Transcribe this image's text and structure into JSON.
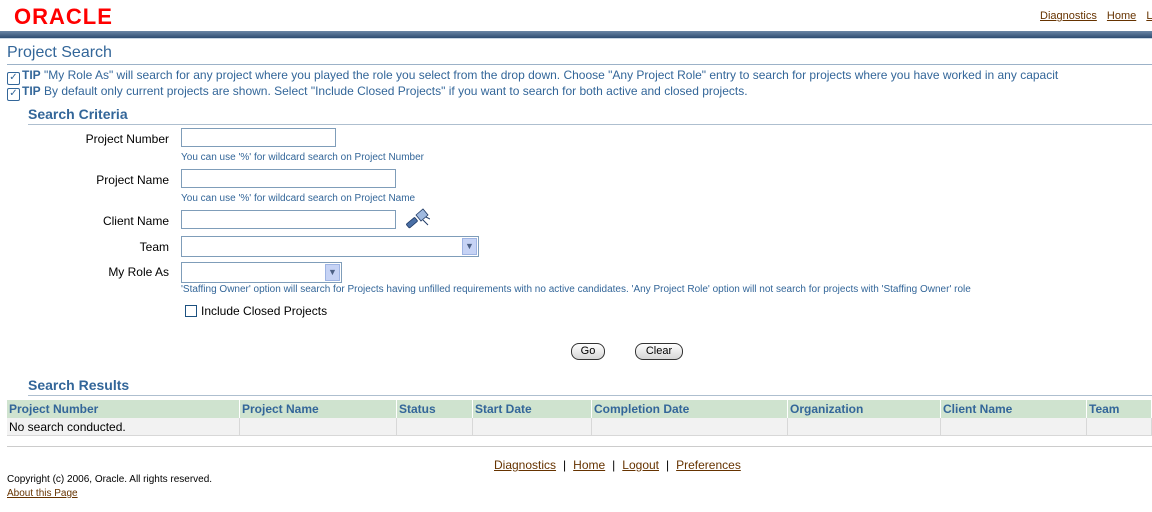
{
  "brand": {
    "logo_text": "ORACLE"
  },
  "global_links": [
    "Diagnostics",
    "Home",
    "Lo"
  ],
  "page_title": "Project Search",
  "tips": [
    {
      "label": "TIP",
      "text": "\"My Role As\" will search for any project where you played the role you select from the drop down. Choose \"Any Project Role\" entry to search for projects where you have worked in any capacit"
    },
    {
      "label": "TIP",
      "text": "By default only current projects are shown. Select \"Include Closed Projects\" if you want to search for both active and closed projects."
    }
  ],
  "search_criteria": {
    "heading": "Search Criteria",
    "project_number": {
      "label": "Project Number",
      "value": "",
      "hint": "You can use '%' for wildcard search on Project Number"
    },
    "project_name": {
      "label": "Project Name",
      "value": "",
      "hint": "You can use '%' for wildcard search on Project Name"
    },
    "client_name": {
      "label": "Client Name",
      "value": "",
      "icon": "flashlight-search-icon"
    },
    "team": {
      "label": "Team",
      "selected": ""
    },
    "my_role_as": {
      "label": "My Role As",
      "selected": "",
      "hint": "'Staffing Owner' option will search for Projects having unfilled requirements with no active candidates. 'Any Project Role' option will not search for projects with 'Staffing Owner' role"
    },
    "include_closed": {
      "label": "Include Closed Projects",
      "checked": false
    },
    "go_label": "Go",
    "clear_label": "Clear"
  },
  "search_results": {
    "heading": "Search Results",
    "columns": [
      "Project Number",
      "Project Name",
      "Status",
      "Start Date",
      "Completion Date",
      "Organization",
      "Client Name",
      "Team"
    ],
    "empty_message": "No search conducted."
  },
  "footer": {
    "links": [
      "Diagnostics",
      "Home",
      "Logout",
      "Preferences"
    ],
    "copyright": "Copyright (c) 2006, Oracle. All rights reserved.",
    "about": "About this Page"
  },
  "colors": {
    "brand_red": "#ff0000",
    "heading_blue": "#336699",
    "link_brown": "#663300",
    "table_header": "#cfe3cf"
  }
}
